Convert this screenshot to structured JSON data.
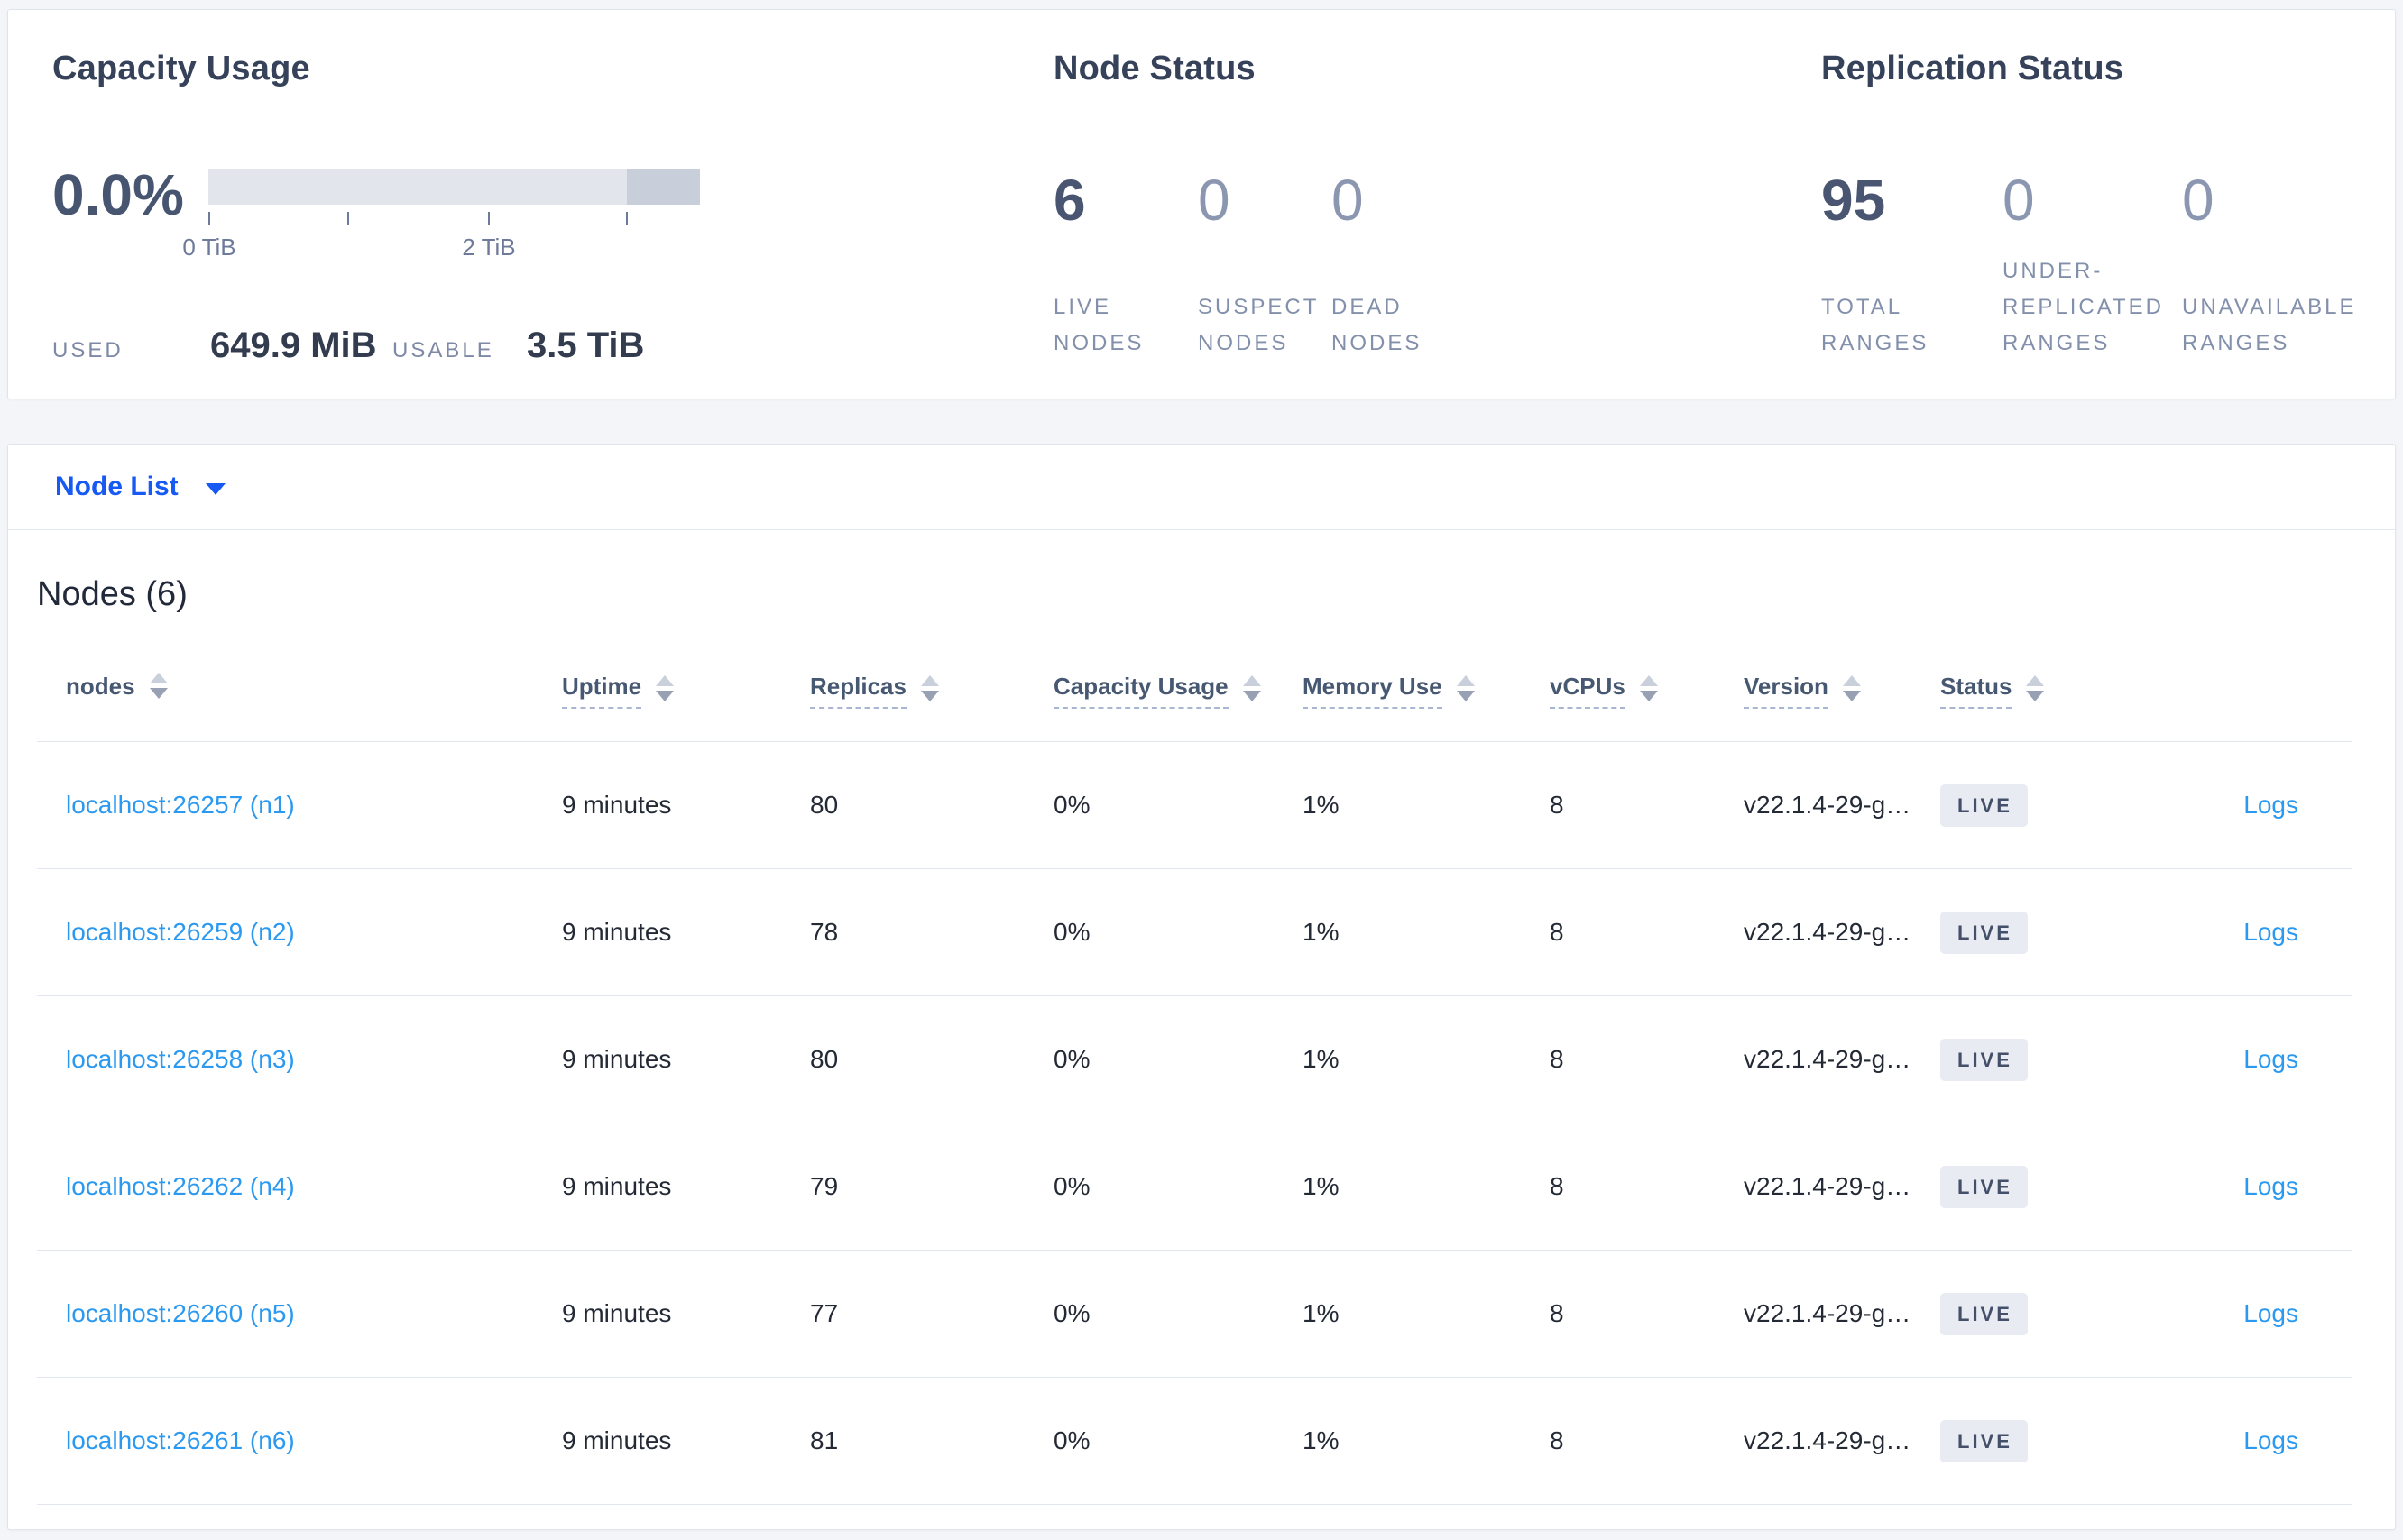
{
  "summary": {
    "capacity": {
      "title": "Capacity Usage",
      "percent": "0.0%",
      "ticks": [
        "0 TiB",
        "2 TiB"
      ],
      "used_label": "USED",
      "used_value": "649.9 MiB",
      "usable_label": "USABLE",
      "usable_value": "3.5 TiB"
    },
    "node_status": {
      "title": "Node Status",
      "stats": [
        {
          "value": "6",
          "label": "LIVE NODES"
        },
        {
          "value": "0",
          "label": "SUSPECT NODES"
        },
        {
          "value": "0",
          "label": "DEAD NODES"
        }
      ]
    },
    "replication": {
      "title": "Replication Status",
      "stats": [
        {
          "value": "95",
          "label": "TOTAL RANGES"
        },
        {
          "value": "0",
          "label": "UNDER-REPLICATED RANGES"
        },
        {
          "value": "0",
          "label": "UNAVAILABLE RANGES"
        }
      ]
    }
  },
  "view_selector": {
    "label": "Node List"
  },
  "table": {
    "title": "Nodes (6)",
    "columns": [
      {
        "label": "nodes"
      },
      {
        "label": "Uptime"
      },
      {
        "label": "Replicas"
      },
      {
        "label": "Capacity Usage"
      },
      {
        "label": "Memory Use"
      },
      {
        "label": "vCPUs"
      },
      {
        "label": "Version"
      },
      {
        "label": "Status"
      }
    ],
    "rows": [
      {
        "node": "localhost:26257 (n1)",
        "uptime": "9 minutes",
        "replicas": "80",
        "capacity": "0%",
        "memory": "1%",
        "vcpus": "8",
        "version": "v22.1.4-29-g…",
        "status": "LIVE",
        "logs": "Logs"
      },
      {
        "node": "localhost:26259 (n2)",
        "uptime": "9 minutes",
        "replicas": "78",
        "capacity": "0%",
        "memory": "1%",
        "vcpus": "8",
        "version": "v22.1.4-29-g…",
        "status": "LIVE",
        "logs": "Logs"
      },
      {
        "node": "localhost:26258 (n3)",
        "uptime": "9 minutes",
        "replicas": "80",
        "capacity": "0%",
        "memory": "1%",
        "vcpus": "8",
        "version": "v22.1.4-29-g…",
        "status": "LIVE",
        "logs": "Logs"
      },
      {
        "node": "localhost:26262 (n4)",
        "uptime": "9 minutes",
        "replicas": "79",
        "capacity": "0%",
        "memory": "1%",
        "vcpus": "8",
        "version": "v22.1.4-29-g…",
        "status": "LIVE",
        "logs": "Logs"
      },
      {
        "node": "localhost:26260 (n5)",
        "uptime": "9 minutes",
        "replicas": "77",
        "capacity": "0%",
        "memory": "1%",
        "vcpus": "8",
        "version": "v22.1.4-29-g…",
        "status": "LIVE",
        "logs": "Logs"
      },
      {
        "node": "localhost:26261 (n6)",
        "uptime": "9 minutes",
        "replicas": "81",
        "capacity": "0%",
        "memory": "1%",
        "vcpus": "8",
        "version": "v22.1.4-29-g…",
        "status": "LIVE",
        "logs": "Logs"
      }
    ]
  },
  "colors": {
    "selector_blue": "#1659f3",
    "link_blue": "#2b99f0",
    "badge_bg": "#e8ebf1",
    "badge_text": "#44506a",
    "bar_light": "#e2e5ec",
    "bar_dark": "#c9cedb",
    "page_bg": "#f3f5f9"
  }
}
